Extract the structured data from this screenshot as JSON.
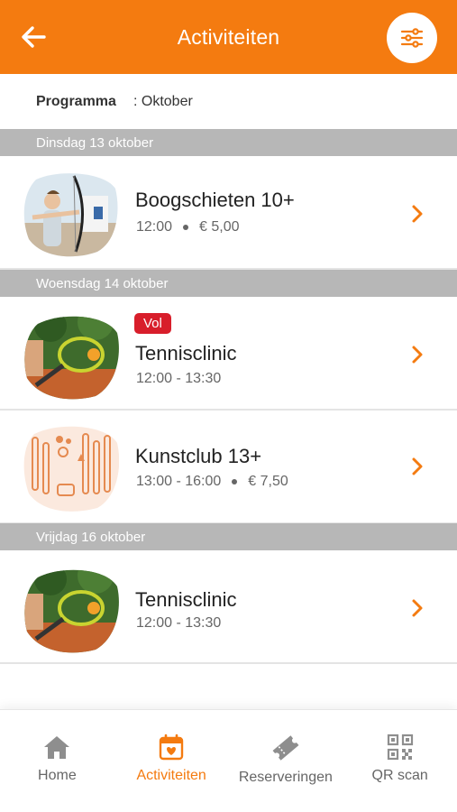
{
  "header": {
    "title": "Activiteiten",
    "back_icon": "arrow-left-icon",
    "filter_icon": "sliders-icon"
  },
  "program": {
    "label": "Programma",
    "value": ": Oktober"
  },
  "days": [
    {
      "label": "Dinsdag 13 oktober",
      "items": [
        {
          "name": "Boogschieten 10+",
          "time": "12:00",
          "price": "€ 5,00",
          "badge": ""
        }
      ]
    },
    {
      "label": "Woensdag 14 oktober",
      "items": [
        {
          "name": "Tennisclinic",
          "time": "12:00 - 13:30",
          "price": "",
          "badge": "Vol"
        },
        {
          "name": "Kunstclub 13+",
          "time": "13:00 - 16:00",
          "price": "€ 7,50",
          "badge": ""
        }
      ]
    },
    {
      "label": "Vrijdag 16 oktober",
      "items": [
        {
          "name": "Tennisclinic",
          "time": "12:00 - 13:30",
          "price": "",
          "badge": ""
        }
      ]
    }
  ],
  "nav": {
    "items": [
      {
        "label": "Home",
        "icon": "home-icon",
        "active": false
      },
      {
        "label": "Activiteiten",
        "icon": "calendar-heart-icon",
        "active": true
      },
      {
        "label": "Reserveringen",
        "icon": "ticket-icon",
        "active": false
      },
      {
        "label": "QR scan",
        "icon": "qr-code-icon",
        "active": false
      }
    ]
  },
  "colors": {
    "accent": "#f47b10",
    "badge": "#d81e2b",
    "day_header": "#b7b7b7"
  }
}
